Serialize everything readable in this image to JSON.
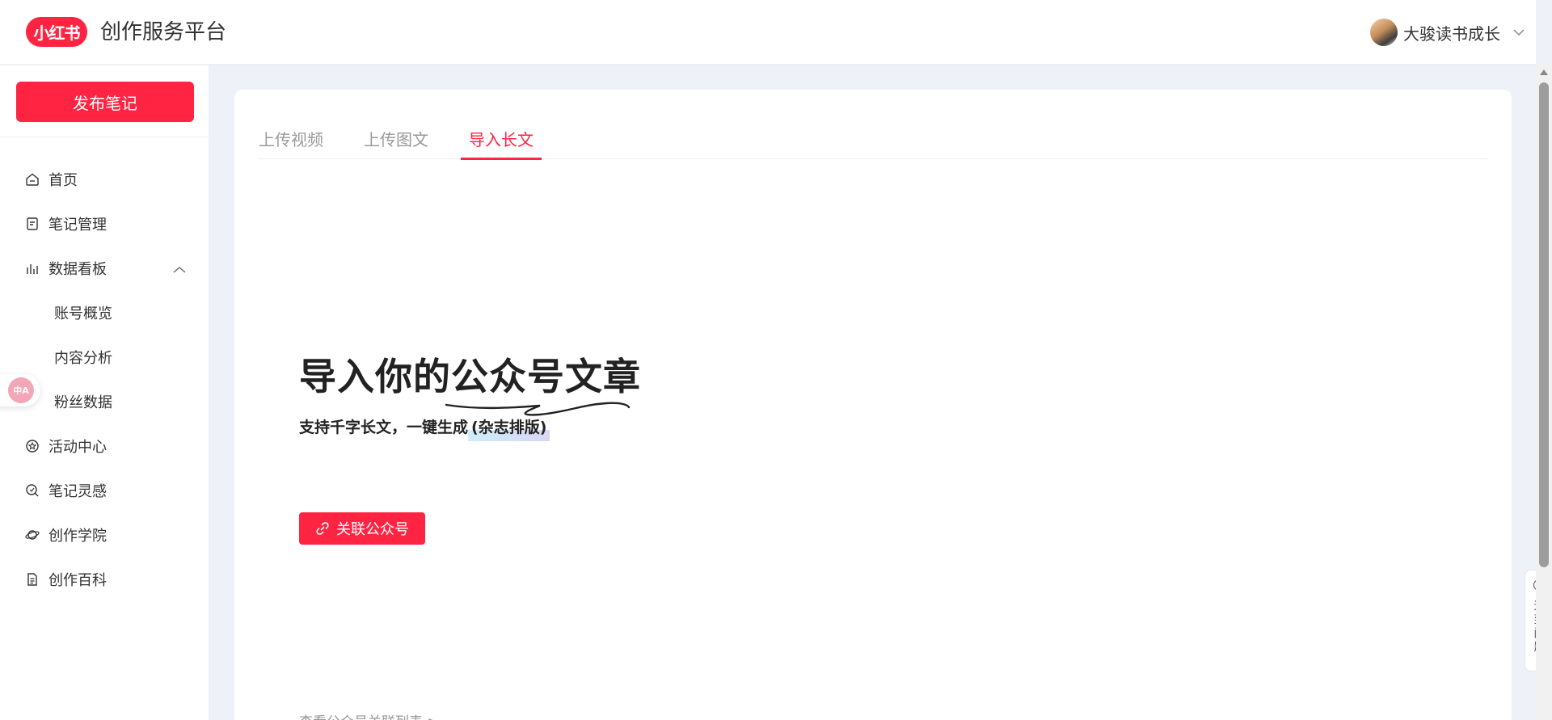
{
  "header": {
    "logo_text": "小红书",
    "platform_title": "创作服务平台",
    "user_name": "大骏读书成长"
  },
  "sidebar": {
    "publish_label": "发布笔记",
    "items": [
      {
        "label": "首页",
        "icon": "home-icon"
      },
      {
        "label": "笔记管理",
        "icon": "note-icon"
      },
      {
        "label": "数据看板",
        "icon": "bar-chart-icon",
        "expanded": true
      },
      {
        "label": "活动中心",
        "icon": "activity-icon"
      },
      {
        "label": "笔记灵感",
        "icon": "inspiration-icon"
      },
      {
        "label": "创作学院",
        "icon": "planet-icon"
      },
      {
        "label": "创作百科",
        "icon": "document-icon"
      }
    ],
    "sub_items": [
      {
        "label": "账号概览"
      },
      {
        "label": "内容分析"
      },
      {
        "label": "粉丝数据"
      }
    ],
    "translate_badge": "中A"
  },
  "tabs": [
    {
      "label": "上传视频",
      "active": false
    },
    {
      "label": "上传图文",
      "active": false
    },
    {
      "label": "导入长文",
      "active": true
    }
  ],
  "hero": {
    "title": "导入你的公众号文章",
    "subtitle_prefix": "支持千字长文，一键生成",
    "subtitle_highlight": "(杂志排版)"
  },
  "link_button_label": "关联公众号",
  "bottom_hint": "查看公众号关联列表 >",
  "help_label": "遇到问题",
  "colors": {
    "brand": "#ff2442",
    "page_bg": "#eef1f7"
  }
}
